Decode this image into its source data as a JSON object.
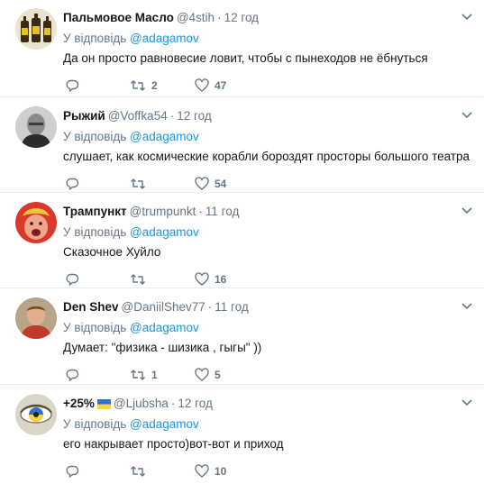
{
  "reply_prefix": "У відповідь",
  "tweets": [
    {
      "name": "Пальмовое Масло",
      "handle": "@4stih",
      "time": "12 год",
      "mention": "@adagamov",
      "text": "Да он просто равновесие ловит, чтобы с пынеходов не ёбнуться",
      "retweets": "2",
      "likes": "47"
    },
    {
      "name": "Рыжий",
      "handle": "@Voffka54",
      "time": "12 год",
      "mention": "@adagamov",
      "text": "слушает, как космические корабли бороздят просторы большого театра",
      "retweets": "",
      "likes": "54"
    },
    {
      "name": "Трампункт",
      "handle": "@trumpunkt",
      "time": "11 год",
      "mention": "@adagamov",
      "text": "Сказочное Хуйло",
      "retweets": "",
      "likes": "16"
    },
    {
      "name": "Den Shev",
      "handle": "@DaniilShev77",
      "time": "11 год",
      "mention": "@adagamov",
      "text": "Думает: \"физика - шизика , гыгы\" ))",
      "retweets": "1",
      "likes": "5"
    },
    {
      "name": "+25%",
      "handle": "@Ljubsha",
      "time": "12 год",
      "mention": "@adagamov",
      "text": "его накрывает просто)вот-вот и приход",
      "retweets": "",
      "likes": "10"
    }
  ],
  "colors": {
    "link": "#1b95e0",
    "secondary": "#657786",
    "divider": "#e6ecf0",
    "flag_blue": "#2f6fd6",
    "flag_yellow": "#ffd23f"
  }
}
